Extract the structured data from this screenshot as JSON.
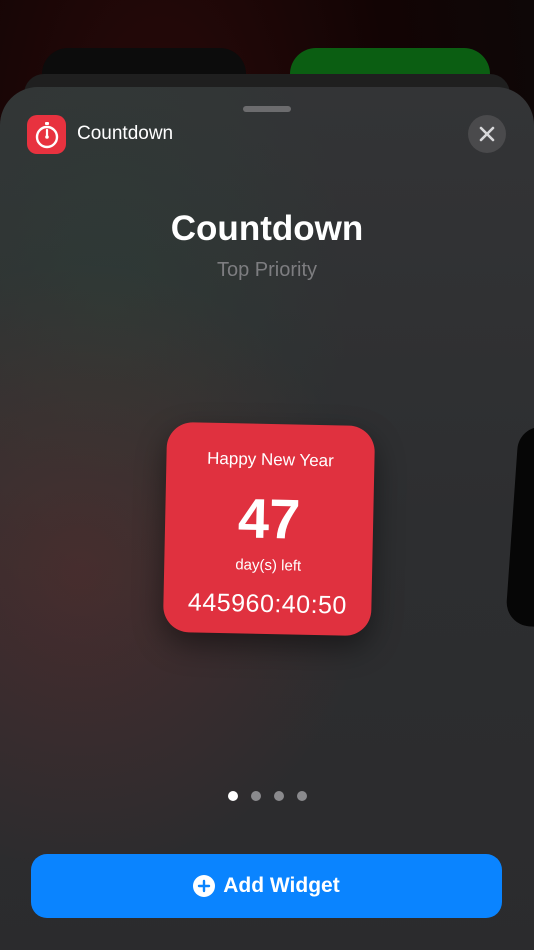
{
  "header": {
    "app_name": "Countdown",
    "app_icon": "stopwatch-icon",
    "close_icon": "close-icon"
  },
  "widget": {
    "title": "Countdown",
    "subtitle": "Top Priority",
    "event_name": "Happy New Year",
    "days": "47",
    "days_label": "day(s) left",
    "timer": "445960:40:50",
    "color": "#e0313f"
  },
  "pagination": {
    "count": 4,
    "active_index": 0
  },
  "footer": {
    "add_label": "Add Widget",
    "add_icon": "plus-circle-icon",
    "accent": "#0a84ff"
  }
}
